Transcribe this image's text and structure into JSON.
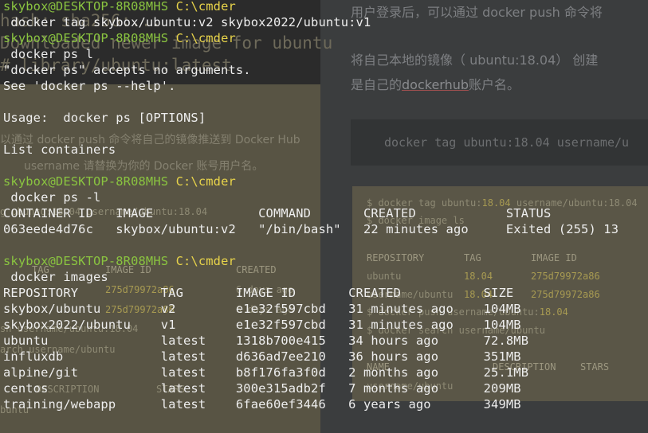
{
  "background_layer": {
    "doc_lines": [
      "用户登录后，可以通过 docker push 命令将",
      "将自己本地的镜像（ ubuntu:18.04） 创建",
      "是自己的",
      "dockerhub",
      "账户名。"
    ],
    "doc_code": "docker tag ubuntu:18.04 username/u",
    "ghost_panel": {
      "cmd1_prefix": "$ docker tag ubuntu:",
      "cmd1_num": "18.04",
      "cmd1_suffix": " username/ubuntu:18.04",
      "cmd2": "$ docker image ls",
      "headers": [
        "REPOSITORY",
        "TAG",
        "IMAGE ID"
      ],
      "rows": [
        [
          "ubuntu",
          "18.04",
          "275d79972a86"
        ],
        [
          "username/ubuntu",
          "18.04",
          "275d79972a86"
        ]
      ],
      "cmd3_prefix": "$ docker push username/ubuntu:",
      "cmd3_num": "18.04",
      "cmd4": "$ docker search username/ubuntu",
      "search_headers": [
        "NAME",
        "DESCRIPTION",
        "STARS"
      ],
      "search_row": "username/ubuntu"
    },
    "left_ghost": {
      "top_hash": "hash: sha256:...",
      "downloaded": "Downloaded newer image for ubuntu",
      "library": "# library/ubuntu:latest",
      "zh1": "以通过 docker push 命令将自己的镜像推送到 Docker Hub",
      "zh2": "username 请替换为你的 Docker 账号用户名。",
      "tag_line": "g ubuntu:18.04 username/ubuntu:18.04",
      "tag_header_tag": "TAG",
      "tag_header_id": "IMAGE ID",
      "tag_header_created": "CREATED",
      "r1_id": "275d79972a86",
      "r1_created": "6 days ago",
      "r2_id": "275d79972a86",
      "r2_created": "6 days ago",
      "push_line": "sh username/ubuntu:18.04",
      "search_line": "arch username/ubuntu",
      "desc_col": "DESCRIPTION",
      "stars_col": "STARS",
      "ubuntu_word": "buntu"
    }
  },
  "terminal": {
    "prompt_user": "skybox@DESKTOP-8R08MHS",
    "prompt_path": "C:\\cmder",
    "lines": [
      {
        "prompt": true
      },
      {
        "text": " docker tag skybox/ubuntu:v2 skybox2022/ubuntu:v1"
      },
      {
        "prompt": true
      },
      {
        "text": " docker ps l"
      },
      {
        "text": "\"docker ps\" accepts no arguments."
      },
      {
        "text": "See 'docker ps --help'."
      },
      {
        "text": ""
      },
      {
        "text": "Usage:  docker ps [OPTIONS]"
      },
      {
        "text": ""
      },
      {
        "text": "List containers"
      },
      {
        "text": ""
      },
      {
        "prompt": true
      },
      {
        "text": " docker ps -l"
      },
      {
        "text": "CONTAINER ID   IMAGE              COMMAND       CREATED            STATUS"
      },
      {
        "text": "063eede4d76c   skybox/ubuntu:v2   \"/bin/bash\"   22 minutes ago     Exited (255) 13"
      },
      {
        "text": ""
      },
      {
        "prompt": true
      },
      {
        "text": " docker images"
      },
      {
        "text": "REPOSITORY           TAG       IMAGE ID       CREATED           SIZE"
      },
      {
        "text": "skybox/ubuntu        v2        e1e32f597cbd   31 minutes ago    104MB"
      },
      {
        "text": "skybox2022/ubuntu    v1        e1e32f597cbd   31 minutes ago    104MB"
      },
      {
        "text": "ubuntu               latest    1318b700e415   34 hours ago      72.8MB"
      },
      {
        "text": "influxdb             latest    d636ad7ee210   36 hours ago      351MB"
      },
      {
        "text": "alpine/git           latest    b8f176fa3f0d   2 months ago      25.1MB"
      },
      {
        "text": "centos               latest    300e315adb2f   7 months ago      209MB"
      },
      {
        "text": "training/webapp      latest    6fae60ef3446   6 years ago       349MB"
      }
    ]
  },
  "colors": {
    "prompt_user": "#8ac440",
    "prompt_path": "#e8d44a",
    "terminal_text": "#eeeeee"
  }
}
